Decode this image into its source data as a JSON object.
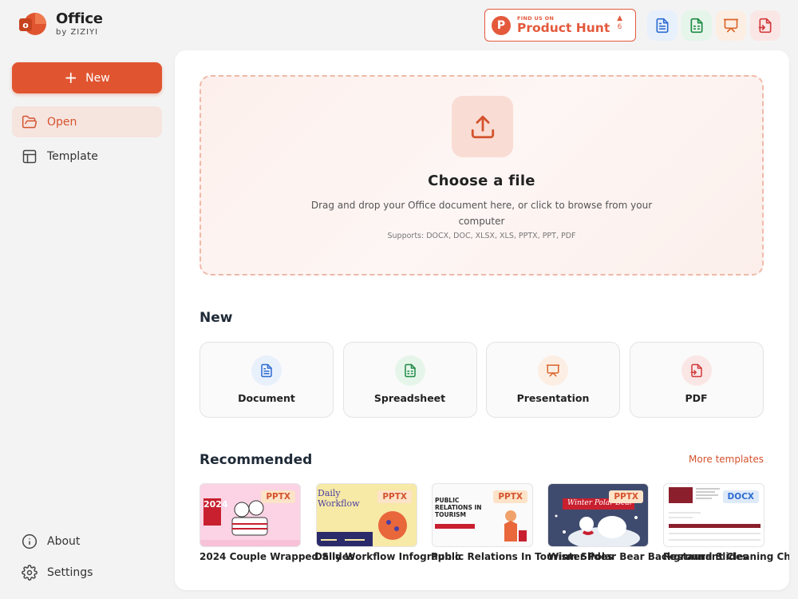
{
  "brand": {
    "title": "Office",
    "subtitle": "by ZIZIYI",
    "logo_letter": "o"
  },
  "product_hunt": {
    "letter": "P",
    "small": "FIND US ON",
    "big": "Product Hunt",
    "arrow": "▲",
    "votes": "6"
  },
  "top_icons": [
    {
      "name": "document-icon",
      "color": "#2d6bd0",
      "bg": "#e8f0fc"
    },
    {
      "name": "spreadsheet-icon",
      "color": "#1e8a44",
      "bg": "#e6f5ea"
    },
    {
      "name": "presentation-icon",
      "color": "#d9662b",
      "bg": "#fdeee3"
    },
    {
      "name": "pdf-icon",
      "color": "#d23b3b",
      "bg": "#fbe6e6"
    }
  ],
  "sidebar": {
    "new_label": "New",
    "items": [
      {
        "label": "Open",
        "icon": "folder-open-icon"
      },
      {
        "label": "Template",
        "icon": "layout-template-icon"
      }
    ],
    "bottom": [
      {
        "label": "About",
        "icon": "info-icon"
      },
      {
        "label": "Settings",
        "icon": "gear-icon"
      }
    ]
  },
  "dropzone": {
    "title": "Choose a file",
    "description": "Drag and drop your Office document here, or click to browse from your computer",
    "supports": "Supports: DOCX, DOC, XLSX, XLS, PPTX, PPT, PDF"
  },
  "new_section": {
    "title": "New",
    "cards": [
      {
        "label": "Document",
        "icon": "document-icon"
      },
      {
        "label": "Spreadsheet",
        "icon": "spreadsheet-icon"
      },
      {
        "label": "Presentation",
        "icon": "presentation-icon"
      },
      {
        "label": "PDF",
        "icon": "pdf-icon"
      }
    ]
  },
  "recommended": {
    "title": "Recommended",
    "more": "More templates",
    "items": [
      {
        "title": "2024 Couple Wrapped Slides",
        "badge": "PPTX",
        "thumb_text": "2024"
      },
      {
        "title": "Daily Workflow Infographic",
        "badge": "PPTX",
        "thumb_text": "Daily Workflow"
      },
      {
        "title": "Public Relations In Tourism Slides",
        "badge": "PPTX",
        "thumb_text": "PUBLIC RELATIONS IN TOURISM"
      },
      {
        "title": "Winter Polar Bear Background Slides",
        "badge": "PPTX",
        "thumb_text": "Winter Polar Bear"
      },
      {
        "title": "Restaurant Cleaning Checklist",
        "badge": "DOCX",
        "thumb_text": ""
      }
    ]
  },
  "colors": {
    "accent": "#e05530",
    "open_bg": "#f6e4df"
  }
}
